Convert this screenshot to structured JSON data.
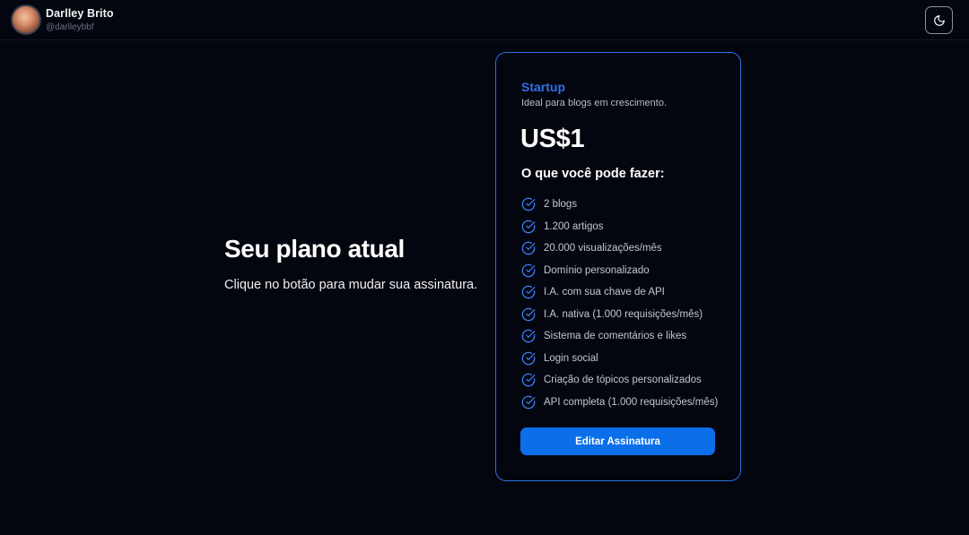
{
  "user": {
    "name": "Darlley Brito",
    "handle": "@darlleybbf"
  },
  "header": {
    "theme_toggle_icon": "moon-icon"
  },
  "main": {
    "title": "Seu plano atual",
    "subtitle": "Clique no botão para mudar sua assinatura."
  },
  "plan": {
    "name": "Startup",
    "description": "Ideal para blogs em crescimento.",
    "price": "US$1",
    "features_title": "O que você pode fazer:",
    "features": [
      "2 blogs",
      "1.200 artigos",
      "20.000 visualizações/mês",
      "Domínio personalizado",
      "I.A. com sua chave de API",
      "I.A. nativa (1.000 requisições/mês)",
      "Sistema de comentários e likes",
      "Login social",
      "Criação de tópicos personalizados",
      "API completa (1.000 requisições/mês)"
    ],
    "feature_icon": "check-circle-icon",
    "button_label": "Editar Assinatura"
  },
  "colors": {
    "background": "#03050f",
    "accent": "#2f72e6",
    "button": "#0b6fea",
    "card_border": "#2d6fe0"
  }
}
